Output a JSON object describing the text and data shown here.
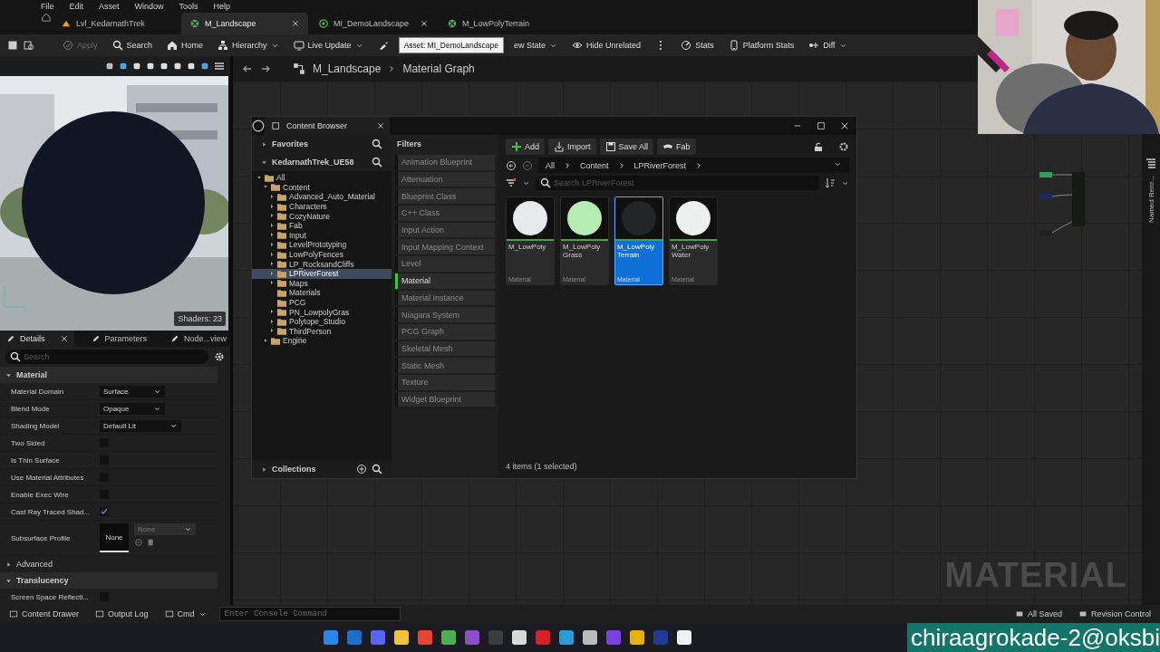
{
  "menu": [
    "File",
    "Edit",
    "Asset",
    "Window",
    "Tools",
    "Help"
  ],
  "tabs": [
    {
      "label": "Lvl_KedarnathTrek",
      "kind": "level",
      "selected": false,
      "closable": false
    },
    {
      "label": "M_Landscape",
      "kind": "material",
      "selected": true,
      "closable": true
    },
    {
      "label": "MI_DemoLandscape",
      "kind": "instance",
      "selected": false,
      "closable": true
    },
    {
      "label": "M_LowPolyTerrain",
      "kind": "material",
      "selected": false,
      "closable": false
    }
  ],
  "toolbar": [
    {
      "kind": "button",
      "label": "Apply",
      "disabled": true,
      "dropdown": false
    },
    {
      "kind": "button",
      "label": "Search",
      "disabled": false,
      "dropdown": false
    },
    {
      "kind": "button",
      "label": "Home",
      "disabled": false,
      "dropdown": false
    },
    {
      "kind": "button",
      "label": "Hierarchy",
      "disabled": false,
      "dropdown": true
    },
    {
      "kind": "button",
      "label": "Live Update",
      "disabled": false,
      "dropdown": true
    },
    {
      "kind": "icon"
    },
    {
      "kind": "tooltip",
      "label": "Asset: MI_DemoLandscape"
    },
    {
      "kind": "button",
      "label": "ew State",
      "disabled": false,
      "dropdown": true
    },
    {
      "kind": "button",
      "label": "Hide Unrelated",
      "disabled": false,
      "dropdown": false
    },
    {
      "kind": "icon"
    },
    {
      "kind": "button",
      "label": "Stats",
      "disabled": false,
      "dropdown": false
    },
    {
      "kind": "button",
      "label": "Platform Stats",
      "disabled": false,
      "dropdown": false
    },
    {
      "kind": "button",
      "label": "Diff",
      "disabled": false,
      "dropdown": true
    }
  ],
  "viewport": {
    "badge": "Shaders: 23"
  },
  "details_tabs": [
    {
      "label": "Details",
      "selected": true,
      "closable": true
    },
    {
      "label": "Parameters",
      "selected": false,
      "closable": false
    },
    {
      "label": "Node...view",
      "selected": false,
      "closable": false
    }
  ],
  "details_search": {
    "placeholder": "Search"
  },
  "sections": [
    {
      "title": "Material",
      "kind": "category",
      "expanded": true,
      "rows": [
        {
          "label": "Material Domain",
          "kind": "dropdown",
          "value": "Surface",
          "wide": false
        },
        {
          "label": "Blend Mode",
          "kind": "dropdown",
          "value": "Opaque",
          "wide": false
        },
        {
          "label": "Shading Model",
          "kind": "dropdown",
          "value": "Default Lit",
          "wide": true
        },
        {
          "label": "Two Sided",
          "kind": "checkbox",
          "checked": false
        },
        {
          "label": "Is Thin Surface",
          "kind": "checkbox",
          "checked": false
        },
        {
          "label": "Use Material Attributes",
          "kind": "checkbox",
          "checked": false
        },
        {
          "label": "Enable Exec Wire",
          "kind": "checkbox",
          "checked": false
        },
        {
          "label": "Cast Ray Traced Shad...",
          "kind": "checkbox",
          "checked": true
        },
        {
          "label": "Subsurface Profile",
          "kind": "profile",
          "thumb": "None",
          "value": "None"
        }
      ]
    },
    {
      "title": "Advanced",
      "kind": "sub",
      "expanded": false
    },
    {
      "title": "Translucency",
      "kind": "category",
      "expanded": true,
      "rows": [
        {
          "label": "Screen Space Reflecti...",
          "kind": "checkbox",
          "checked": false
        }
      ]
    }
  ],
  "breadcrumb": [
    "M_Landscape",
    "Material Graph"
  ],
  "graph": {
    "watermark": "MATERIAL",
    "side_tab": "Named Rero..."
  },
  "content_browser": {
    "title": "Content Browser",
    "favorites": "Favorites",
    "project": "KedarnathTrek_UE58",
    "tree": [
      {
        "label": "All",
        "expanded": true,
        "selected": false,
        "has_arrow": true,
        "children": [
          {
            "label": "Content",
            "expanded": true,
            "selected": false,
            "has_arrow": true,
            "children": [
              {
                "label": "Advanced_Auto_Material",
                "expanded": false,
                "selected": false,
                "has_arrow": true
              },
              {
                "label": "Characters",
                "expanded": false,
                "selected": false,
                "has_arrow": true
              },
              {
                "label": "CozyNature",
                "expanded": false,
                "selected": false,
                "has_arrow": true
              },
              {
                "label": "Fab",
                "expanded": false,
                "selected": false,
                "has_arrow": true
              },
              {
                "label": "Input",
                "expanded": false,
                "selected": false,
                "has_arrow": true
              },
              {
                "label": "LevelPrototyping",
                "expanded": false,
                "selected": false,
                "has_arrow": true
              },
              {
                "label": "LowPolyFences",
                "expanded": false,
                "selected": false,
                "has_arrow": true
              },
              {
                "label": "LP_RocksandCliffs",
                "expanded": false,
                "selected": false,
                "has_arrow": true
              },
              {
                "label": "LPRiverForest",
                "expanded": false,
                "selected": true,
                "has_arrow": true
              },
              {
                "label": "Maps",
                "expanded": false,
                "selected": false,
                "has_arrow": true
              },
              {
                "label": "Materials",
                "expanded": false,
                "selected": false,
                "has_arrow": false
              },
              {
                "label": "PCG",
                "expanded": false,
                "selected": false,
                "has_arrow": false
              },
              {
                "label": "PN_LowpolyGras",
                "expanded": false,
                "selected": false,
                "has_arrow": true
              },
              {
                "label": "Polytope_Studio",
                "expanded": false,
                "selected": false,
                "has_arrow": true
              },
              {
                "label": "ThirdPerson",
                "expanded": false,
                "selected": false,
                "has_arrow": true
              }
            ]
          },
          {
            "label": "Engine",
            "expanded": false,
            "selected": false,
            "has_arrow": true
          }
        ]
      }
    ],
    "collections": "Collections",
    "filters_title": "Filters",
    "filters": [
      {
        "label": "Animation Blueprint",
        "active": false
      },
      {
        "label": "Attenuation",
        "active": false
      },
      {
        "label": "Blueprint Class",
        "active": false
      },
      {
        "label": "C++ Class",
        "active": false
      },
      {
        "label": "Input Action",
        "active": false
      },
      {
        "label": "Input Mapping Context",
        "active": false
      },
      {
        "label": "Level",
        "active": false
      },
      {
        "label": "Material",
        "active": true
      },
      {
        "label": "Material Instance",
        "active": false
      },
      {
        "label": "Niagara System",
        "active": false
      },
      {
        "label": "PCG Graph",
        "active": false
      },
      {
        "label": "Skeletal Mesh",
        "active": false
      },
      {
        "label": "Static Mesh",
        "active": false
      },
      {
        "label": "Texture",
        "active": false
      },
      {
        "label": "Widget Blueprint",
        "active": false
      }
    ],
    "buttons": [
      "Add",
      "Import",
      "Save All",
      "Fab"
    ],
    "path": [
      "All",
      "Content",
      "LPRiverForest"
    ],
    "search": {
      "placeholder": "Search LPRiverForest"
    },
    "assets": [
      {
        "name": "M_LowPoly",
        "type": "Material",
        "color": "#e6eaea",
        "selected": false
      },
      {
        "name": "M_LowPoly Grass",
        "type": "Material",
        "color": "#b6ecb2",
        "selected": false
      },
      {
        "name": "M_LowPoly Terrain",
        "type": "Material",
        "color": "#232527",
        "selected": true
      },
      {
        "name": "M_LowPoly Water",
        "type": "Material",
        "color": "#eef0f0",
        "selected": false
      }
    ],
    "status": "4 items (1 selected)"
  },
  "bottom_bar": {
    "left": [
      "Content Drawer",
      "Output Log",
      "Cmd"
    ],
    "console": {
      "placeholder": "Enter Console Command"
    },
    "right": [
      "All Saved",
      "Revision Control"
    ]
  },
  "taskbar": {
    "apps": [
      {
        "color": "#2b86e8"
      },
      {
        "color": "#1a6fd0"
      },
      {
        "color": "#5865f2"
      },
      {
        "color": "#f2c33a"
      },
      {
        "color": "#e94235"
      },
      {
        "color": "#4caf50"
      },
      {
        "color": "#8e4ec6"
      },
      {
        "color": "#3c3c3c"
      },
      {
        "color": "#d9d9d9"
      },
      {
        "color": "#d81f26"
      },
      {
        "color": "#2b9bd6"
      },
      {
        "color": "#bbbbbb"
      },
      {
        "color": "#7a3fe0"
      },
      {
        "color": "#e8b000"
      },
      {
        "color": "#1f3a93"
      },
      {
        "color": "#f0f0f0"
      }
    ],
    "overlay": "chiraagrokade-2@oksbi"
  }
}
